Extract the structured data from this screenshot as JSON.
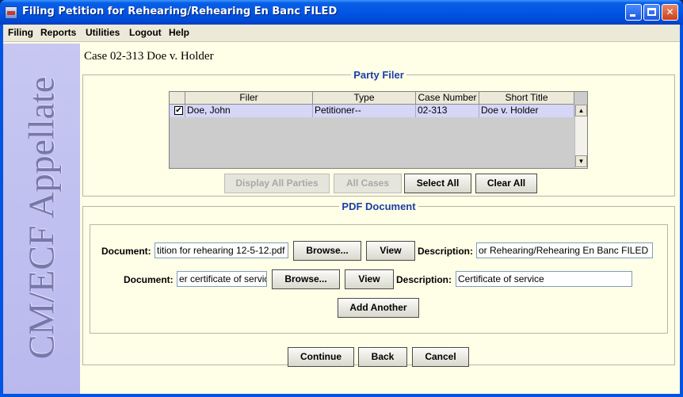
{
  "window": {
    "title": "Filing Petition for Rehearing/Rehearing En Banc FILED"
  },
  "menu": [
    "Filing",
    "Reports",
    "Utilities",
    "Logout",
    "Help"
  ],
  "sidebar": {
    "text": "CM/ECF Appellate"
  },
  "case_title": "Case 02-313 Doe v. Holder",
  "party_filer": {
    "legend": "Party Filer",
    "columns": [
      "Filer",
      "Type",
      "Case Number",
      "Short Title"
    ],
    "rows": [
      {
        "checked": "✔",
        "filer": "Doe, John",
        "type": "Petitioner--",
        "case_number": "02-313",
        "short_title": "Doe v. Holder"
      }
    ],
    "buttons": {
      "display_all": "Display All Parties",
      "all_cases": "All Cases",
      "select_all": "Select All",
      "clear_all": "Clear All"
    }
  },
  "pdf_document": {
    "legend": "PDF Document",
    "document_label": "Document:",
    "description_label": "Description:",
    "browse_label": "Browse...",
    "view_label": "View",
    "rows": [
      {
        "document": "tition for rehearing 12-5-12.pdf",
        "description": "or Rehearing/Rehearing En Banc FILED"
      },
      {
        "document": "er certificate of servic",
        "description": "Certificate of service"
      }
    ],
    "add_another": "Add Another"
  },
  "footer_buttons": {
    "continue": "Continue",
    "back": "Back",
    "cancel": "Cancel"
  }
}
